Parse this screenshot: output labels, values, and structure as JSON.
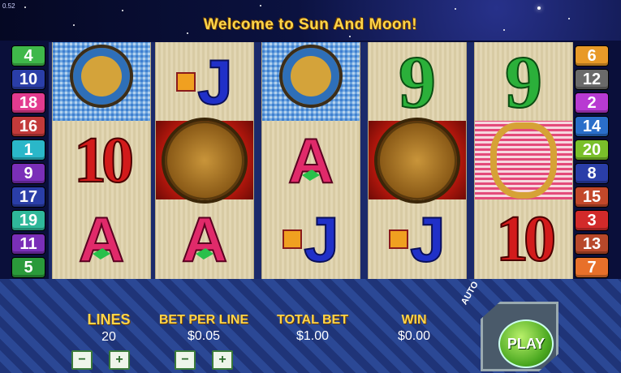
{
  "header": {
    "version": "0.52",
    "welcome": "Welcome to Sun And Moon!"
  },
  "reels": [
    [
      "dreamcatcher",
      "10",
      "A"
    ],
    [
      "J",
      "sun-mask",
      "A"
    ],
    [
      "dreamcatcher",
      "A",
      "J"
    ],
    [
      "9",
      "sun-mask",
      "J"
    ],
    [
      "9",
      "ring",
      "10"
    ]
  ],
  "lines_left": [
    {
      "num": "4",
      "color": "#3fb84a"
    },
    {
      "num": "10",
      "color": "#2a3ea8"
    },
    {
      "num": "18",
      "color": "#e23b8f"
    },
    {
      "num": "16",
      "color": "#c23a3a"
    },
    {
      "num": "1",
      "color": "#2ab7c9"
    },
    {
      "num": "9",
      "color": "#7a2fb8"
    },
    {
      "num": "17",
      "color": "#2a3ea8"
    },
    {
      "num": "19",
      "color": "#2fb89a"
    },
    {
      "num": "11",
      "color": "#7a2fb8"
    },
    {
      "num": "5",
      "color": "#2a9a3a"
    }
  ],
  "lines_right": [
    {
      "num": "6",
      "color": "#e89a28"
    },
    {
      "num": "12",
      "color": "#6a6a6a"
    },
    {
      "num": "2",
      "color": "#b83ad2"
    },
    {
      "num": "14",
      "color": "#2a6ec9"
    },
    {
      "num": "20",
      "color": "#7ac02a"
    },
    {
      "num": "8",
      "color": "#2a3ea8"
    },
    {
      "num": "15",
      "color": "#c2482a"
    },
    {
      "num": "3",
      "color": "#d22a2a"
    },
    {
      "num": "13",
      "color": "#b8482a"
    },
    {
      "num": "7",
      "color": "#e8702a"
    }
  ],
  "controls": {
    "lines_label": "LINES",
    "lines_value": "20",
    "bet_label": "BET PER LINE",
    "bet_value": "$0.05",
    "total_label": "TOTAL BET",
    "total_value": "$1.00",
    "win_label": "WIN",
    "win_value": "$0.00",
    "minus": "−",
    "plus": "+",
    "auto_label": "AUTO",
    "play_label": "PLAY"
  }
}
